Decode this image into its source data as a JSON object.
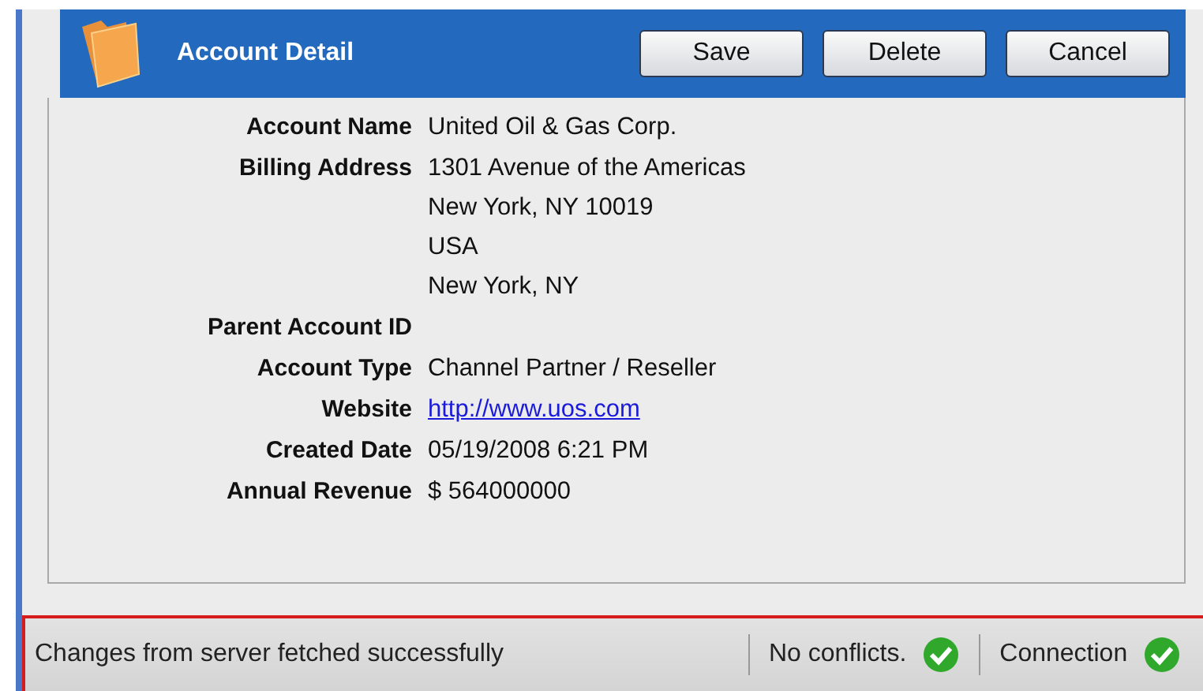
{
  "header": {
    "title": "Account Detail",
    "buttons": [
      "Save",
      "Delete",
      "Cancel"
    ]
  },
  "fields": [
    {
      "label": "Account Name",
      "kind": "text",
      "lines": [
        "United Oil & Gas Corp."
      ]
    },
    {
      "label": "Billing Address",
      "kind": "text",
      "lines": [
        "1301 Avenue of the Americas",
        "New York, NY 10019",
        "USA",
        "New York, NY"
      ]
    },
    {
      "label": "Parent Account ID"
    },
    {
      "label": "Account Type",
      "kind": "text",
      "lines": [
        "Channel Partner / Reseller"
      ]
    },
    {
      "label": "Website",
      "kind": "link",
      "lines": [
        "http://www.uos.com"
      ]
    },
    {
      "label": "Created Date",
      "kind": "text",
      "lines": [
        "05/19/2008 6:21 PM"
      ]
    },
    {
      "label": "Annual Revenue",
      "kind": "text",
      "lines": [
        "$ 564000000"
      ]
    }
  ],
  "status_bar": {
    "message": "Changes from server fetched successfully",
    "indicators": [
      {
        "label": "No conflicts.",
        "ok": true
      },
      {
        "label": "Connection",
        "ok": true
      }
    ]
  }
}
